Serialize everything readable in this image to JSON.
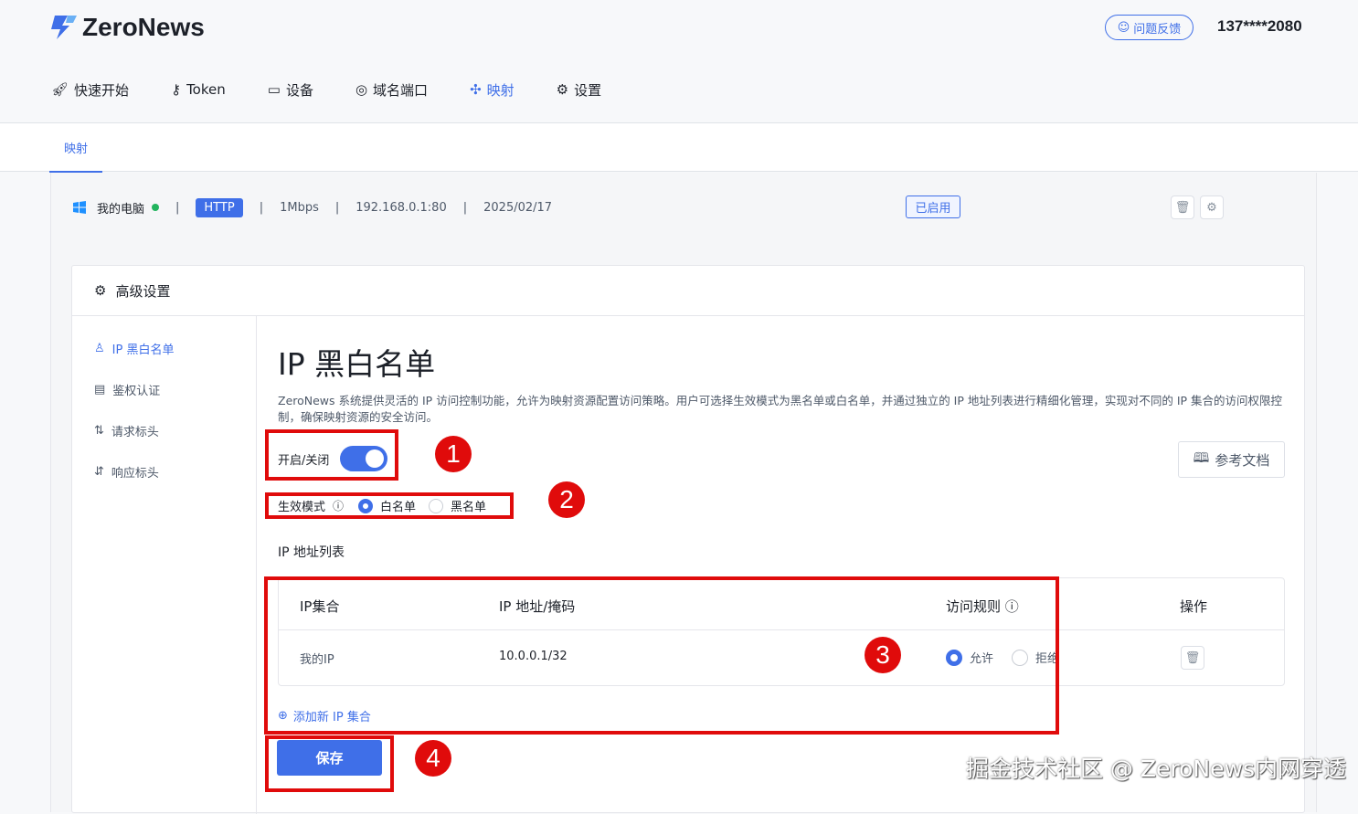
{
  "header": {
    "brand": "ZeroNews",
    "feedback": "问题反馈",
    "user": "137****2080"
  },
  "nav": [
    {
      "label": "快速开始",
      "icon": "rocket-icon"
    },
    {
      "label": "Token",
      "icon": "key-icon"
    },
    {
      "label": "设备",
      "icon": "laptop-icon"
    },
    {
      "label": "域名端口",
      "icon": "globe-icon"
    },
    {
      "label": "映射",
      "icon": "mapping-icon",
      "active": true
    },
    {
      "label": "设置",
      "icon": "gear-icon"
    }
  ],
  "tab": "映射",
  "mapping": {
    "device": "我的电脑",
    "protocol": "HTTP",
    "bandwidth": "1Mbps",
    "address": "192.168.0.1:80",
    "date": "2025/02/17",
    "status": "已启用"
  },
  "panel": {
    "title": "高级设置",
    "side": [
      "IP 黑白名单",
      "鉴权认证",
      "请求标头",
      "响应标头"
    ]
  },
  "content": {
    "title": "IP 黑白名单",
    "desc": "ZeroNews 系统提供灵活的 IP 访问控制功能，允许为映射资源配置访问策略。用户可选择生效模式为黑名单或白名单，并通过独立的 IP 地址列表进行精细化管理，实现对不同的 IP 集合的访问权限控制，确保映射资源的安全访问。",
    "toggle_label": "开启/关闭",
    "toggle_on": true,
    "mode_label": "生效模式",
    "mode_options": [
      "白名单",
      "黑名单"
    ],
    "mode_selected": "白名单",
    "doc_button": "参考文档",
    "list_label": "IP 地址列表",
    "columns": [
      "IP集合",
      "IP 地址/掩码",
      "访问规则",
      "操作"
    ],
    "rows": [
      {
        "name": "我的IP",
        "cidr": "10.0.0.1/32",
        "rule_options": [
          "允许",
          "拒绝"
        ],
        "rule": "允许"
      }
    ],
    "add": "添加新 IP 集合",
    "save": "保存"
  },
  "annotations": [
    "1",
    "2",
    "3",
    "4"
  ],
  "watermark": "掘金技术社区 @ ZeroNews内网穿透",
  "colors": {
    "accent": "#3f6fe8",
    "annotation": "#e00b0b",
    "online": "#22b45e"
  }
}
